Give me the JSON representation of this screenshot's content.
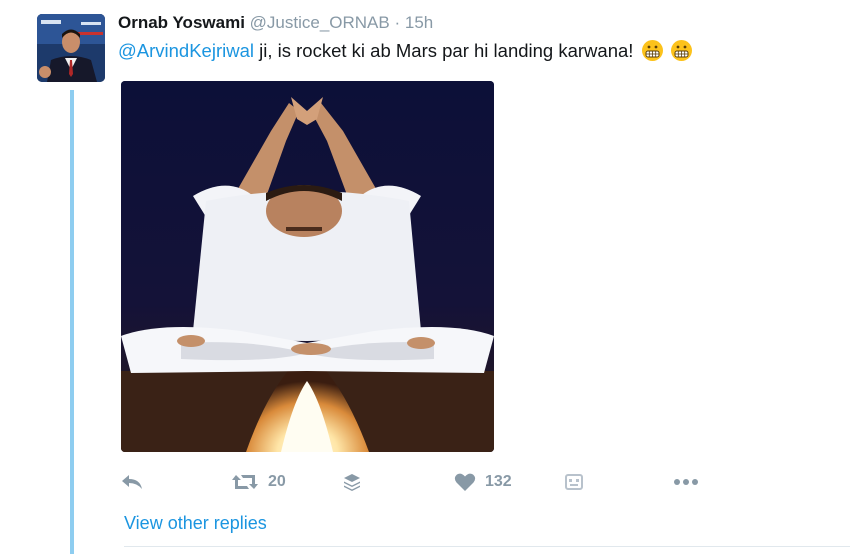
{
  "tweet": {
    "name": "Ornab Yoswami",
    "handle": "@Justice_ORNAB",
    "separator": "·",
    "time": "15h",
    "mention": "@ArvindKejriwal",
    "text": " ji, is rocket ki ab Mars par hi landing karwana!",
    "emoji_icon": "grimacing-face-emoji",
    "media_icon": "meditating-man-rocket-image"
  },
  "actions": {
    "retweet_count": "20",
    "like_count": "132"
  },
  "replies": {
    "view_more_label": "View other replies"
  },
  "colors": {
    "link": "#1b95e0",
    "thread_line": "#8ecdf0",
    "muted": "#8899a6"
  }
}
